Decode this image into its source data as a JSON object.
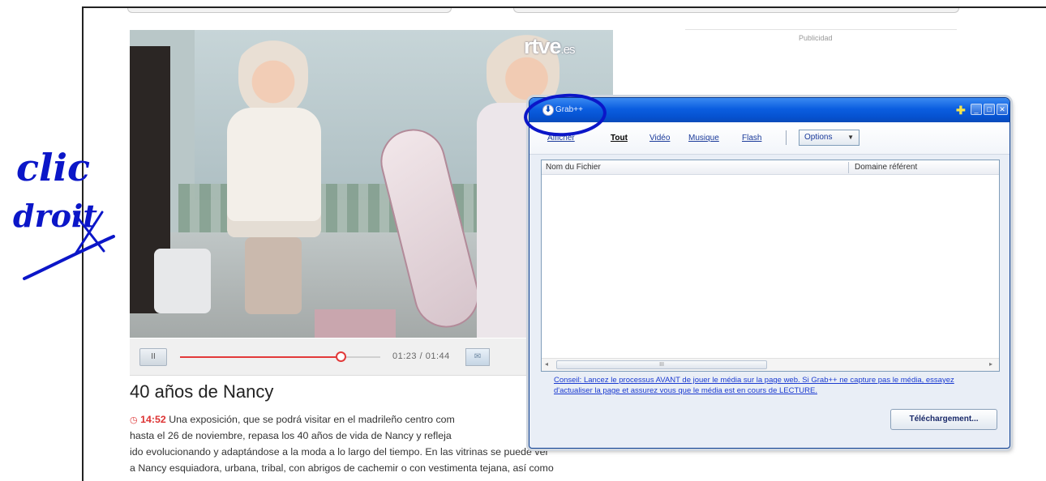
{
  "page": {
    "ad_label": "Publicidad"
  },
  "video": {
    "logo": "rtve",
    "logo_suffix": ".es",
    "pause_symbol": "II",
    "current_time": "01:23",
    "total_time": "01:44",
    "time_separator": " / ",
    "progress_fraction": 0.8,
    "share_symbol": "✉"
  },
  "article": {
    "title": "40 años de Nancy",
    "clock_icon": "◷",
    "timestamp": "14:52",
    "lines": [
      "Una exposición, que se podrá visitar en el madrileño centro com",
      "hasta el 26 de noviembre, repasa los 40 años de vida de Nancy y refleja",
      "ido evolucionando y adaptándose a la moda a lo largo del tiempo. En las vitrinas se puede ver",
      "a Nancy esquiadora, urbana, tribal, con abrigos de cachemir o con vestimenta tejana, así como"
    ]
  },
  "grab_window": {
    "title": "Grab++",
    "app_icon": "⬇",
    "pin_symbol": "✚",
    "controls": {
      "minimize": "_",
      "maximize": "□",
      "close": "✕"
    },
    "toolbar": {
      "hidden_item": "Afficher",
      "items": [
        "Tout",
        "Vidéo",
        "Musique",
        "Flash"
      ],
      "options_label": "Options",
      "options_caret": "▼"
    },
    "list": {
      "columns": [
        "Nom du Fichier",
        "Domaine référent"
      ],
      "scroll_left": "◂",
      "scroll_right": "▸",
      "thumb_grip": "III"
    },
    "tip": "Conseil: Lancez le processus AVANT de jouer le média sur la page web. Si Grab++ ne capture pas le média, essayez d'actualiser la page et assurez vous que le média est en cours de LECTURE.",
    "download_button": "Téléchargement..."
  },
  "annotations": {
    "handwritten_line1": "clic",
    "handwritten_line2": "droit",
    "ink_color": "#0b16c8"
  }
}
